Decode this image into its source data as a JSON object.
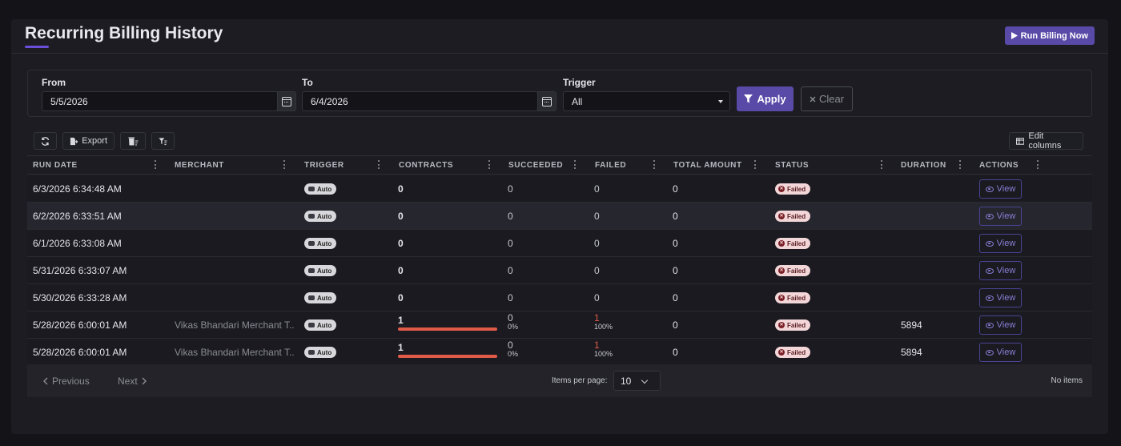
{
  "page": {
    "title": "Recurring Billing History",
    "run_button": "Run Billing Now"
  },
  "filters": {
    "from_label": "From",
    "from_value": "5/5/2026",
    "to_label": "To",
    "to_value": "6/4/2026",
    "trigger_label": "Trigger",
    "trigger_value": "All",
    "apply_label": "Apply",
    "clear_label": "Clear"
  },
  "toolbar": {
    "export_label": "Export",
    "edit_columns_label": "Edit columns"
  },
  "columns": [
    "RUN DATE",
    "MERCHANT",
    "TRIGGER",
    "CONTRACTS",
    "SUCCEEDED",
    "FAILED",
    "TOTAL AMOUNT",
    "STATUS",
    "DURATION",
    "ACTIONS"
  ],
  "rows": [
    {
      "run_date": "6/3/2026 6:34:48 AM",
      "merchant": "",
      "trigger": "Auto",
      "contracts": "0",
      "succeeded": "0",
      "succeeded_pct": "",
      "failed": "0",
      "failed_pct": "",
      "total_amount": "0",
      "status": "Failed",
      "duration": "",
      "action": "View"
    },
    {
      "run_date": "6/2/2026 6:33:51 AM",
      "merchant": "",
      "trigger": "Auto",
      "contracts": "0",
      "succeeded": "0",
      "succeeded_pct": "",
      "failed": "0",
      "failed_pct": "",
      "total_amount": "0",
      "status": "Failed",
      "duration": "",
      "action": "View"
    },
    {
      "run_date": "6/1/2026 6:33:08 AM",
      "merchant": "",
      "trigger": "Auto",
      "contracts": "0",
      "succeeded": "0",
      "succeeded_pct": "",
      "failed": "0",
      "failed_pct": "",
      "total_amount": "0",
      "status": "Failed",
      "duration": "",
      "action": "View"
    },
    {
      "run_date": "5/31/2026 6:33:07 AM",
      "merchant": "",
      "trigger": "Auto",
      "contracts": "0",
      "succeeded": "0",
      "succeeded_pct": "",
      "failed": "0",
      "failed_pct": "",
      "total_amount": "0",
      "status": "Failed",
      "duration": "",
      "action": "View"
    },
    {
      "run_date": "5/30/2026 6:33:28 AM",
      "merchant": "",
      "trigger": "Auto",
      "contracts": "0",
      "succeeded": "0",
      "succeeded_pct": "",
      "failed": "0",
      "failed_pct": "",
      "total_amount": "0",
      "status": "Failed",
      "duration": "",
      "action": "View"
    },
    {
      "run_date": "5/28/2026 6:00:01 AM",
      "merchant": "Vikas Bhandari Merchant T...",
      "trigger": "Auto",
      "contracts": "1",
      "succeeded": "0",
      "succeeded_pct": "0%",
      "failed": "1",
      "failed_pct": "100%",
      "total_amount": "0",
      "status": "Failed",
      "duration": "5894",
      "action": "View"
    },
    {
      "run_date": "5/28/2026 6:00:01 AM",
      "merchant": "Vikas Bhandari Merchant T...",
      "trigger": "Auto",
      "contracts": "1",
      "succeeded": "0",
      "succeeded_pct": "0%",
      "failed": "1",
      "failed_pct": "100%",
      "total_amount": "0",
      "status": "Failed",
      "duration": "5894",
      "action": "View"
    }
  ],
  "pagination": {
    "previous_label": "Previous",
    "next_label": "Next",
    "items_per_page_label": "Items per page:",
    "items_per_page_value": "10",
    "summary": "No items"
  },
  "colors": {
    "accent": "#5a4aa8",
    "failed_red": "#e05a48",
    "status_bg": "#f2d6d8"
  }
}
